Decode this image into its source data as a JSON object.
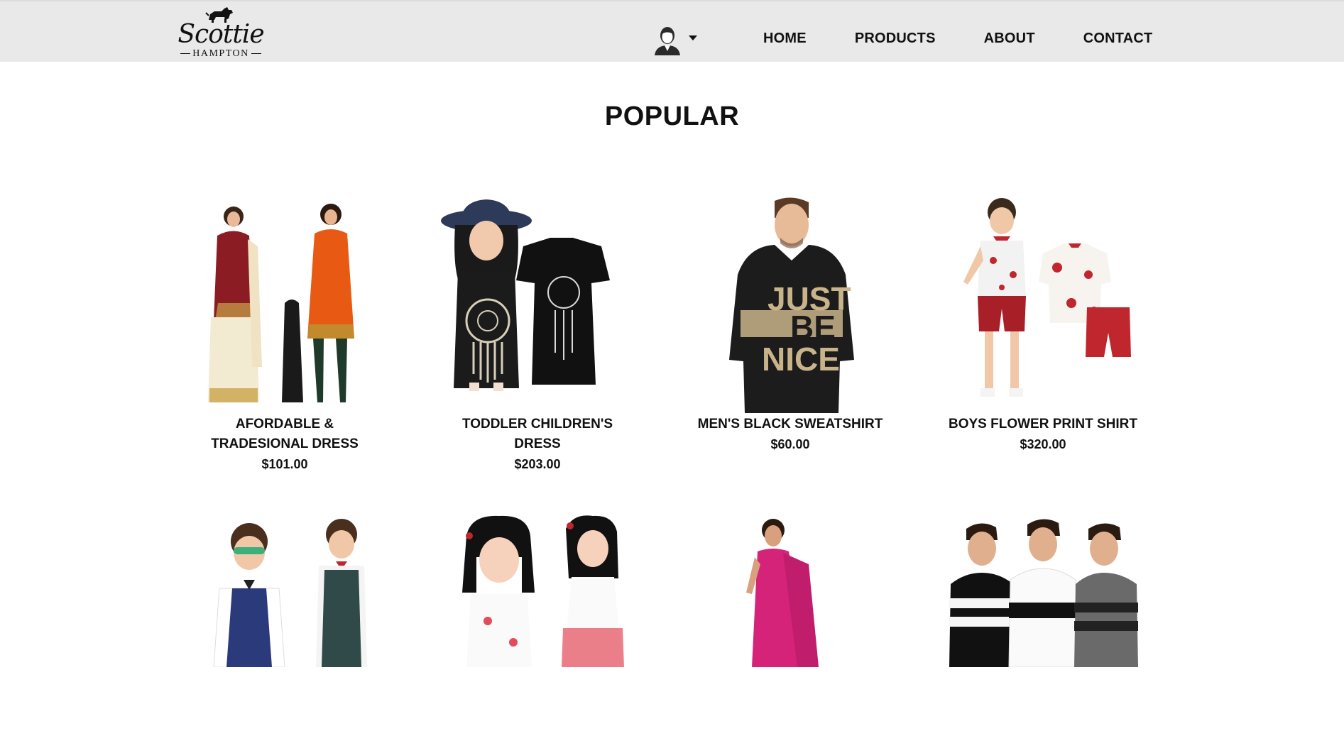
{
  "header": {
    "logo": {
      "brand": "Scottie",
      "sub": "HAMPTON"
    },
    "account_icon": "user-icon",
    "caret_icon": "caret-down-icon",
    "nav": [
      "HOME",
      "PRODUCTS",
      "ABOUT",
      "CONTACT"
    ]
  },
  "main": {
    "title": "POPULAR",
    "products": [
      {
        "name": "AFORDABLE & TRADESIONAL DRESS",
        "price": "$101.00"
      },
      {
        "name": "TODDLER CHILDREN'S DRESS",
        "price": "$203.00"
      },
      {
        "name": "MEN'S BLACK SWEATSHIRT",
        "price": "$60.00"
      },
      {
        "name": "BOYS FLOWER PRINT SHIRT",
        "price": "$320.00"
      }
    ],
    "sweatshirt_print": [
      "JUST",
      "BE",
      "NICE"
    ]
  },
  "colors": {
    "header_bg": "#e9e9e9",
    "text": "#111111",
    "maroon": "#8b1c24",
    "orange": "#e85a14",
    "pink": "#d6237a",
    "red": "#c0262d",
    "tan": "#c9b48a"
  }
}
